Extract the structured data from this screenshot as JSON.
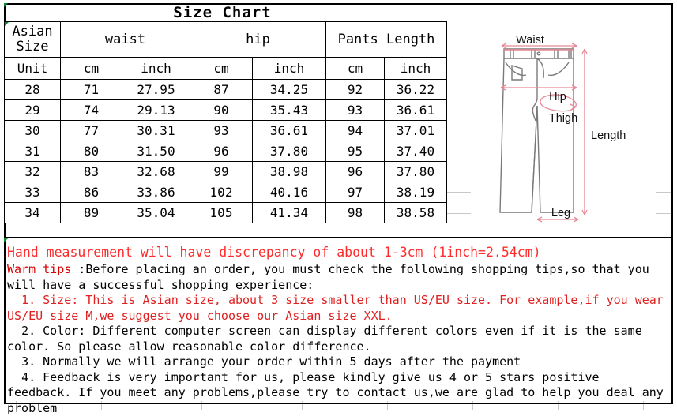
{
  "title": "Size Chart",
  "table": {
    "header_groups": [
      "Asian Size",
      "waist",
      "hip",
      "Pants Length"
    ],
    "asian_size_label_l1": "Asian",
    "asian_size_label_l2": "Size",
    "waist_label": "waist",
    "hip_label": "hip",
    "pants_length_label": "Pants Length",
    "unit_row": [
      "Unit",
      "cm",
      "inch",
      "cm",
      "inch",
      "cm",
      "inch"
    ],
    "rows": [
      [
        "28",
        "71",
        "27.95",
        "87",
        "34.25",
        "92",
        "36.22"
      ],
      [
        "29",
        "74",
        "29.13",
        "90",
        "35.43",
        "93",
        "36.61"
      ],
      [
        "30",
        "77",
        "30.31",
        "93",
        "36.61",
        "94",
        "37.01"
      ],
      [
        "31",
        "80",
        "31.50",
        "96",
        "37.80",
        "95",
        "37.40"
      ],
      [
        "32",
        "83",
        "32.68",
        "99",
        "38.98",
        "96",
        "37.80"
      ],
      [
        "33",
        "86",
        "33.86",
        "102",
        "40.16",
        "97",
        "38.19"
      ],
      [
        "34",
        "89",
        "35.04",
        "105",
        "41.34",
        "98",
        "38.58"
      ]
    ]
  },
  "notes": {
    "line1": "Hand measurement will have discrepancy of about 1-3cm (1inch=2.54cm)",
    "warm_tips_label": "Warm tips",
    "warm_tips_body": " :Before placing an order, you must check the following shopping tips,so that you will have a successful shopping experience:",
    "item1": "  1. Size: This is Asian size, about 3 size smaller than US/EU size. For example,if you wear US/EU size M,we suggest you choose our Asian size XXL.",
    "item2": "  2. Color: Different computer screen can display different colors even if it is the same color. So please allow reasonable color difference.",
    "item3": "  3. Normally we will arrange your order within 5 days after the payment",
    "item4": "  4. Feedback is very important for us, please kindly give us 4 or 5 stars positive feedback. If you meet any problems,please try to contact us,we are glad to help you deal any problem"
  },
  "illustration": {
    "waist_label": "Waist",
    "hip_label": "Hip",
    "thigh_label": "Thigh",
    "length_label": "Length",
    "leg_label": "Leg"
  },
  "colors": {
    "warning_red": "#ff2b2b",
    "emphasis_red": "#d60000",
    "measure_pink": "#e58a96",
    "outline_gray": "#7a7a7a",
    "grid_gray": "#c8c8c8",
    "excel_marker_green": "#0a8a30"
  }
}
